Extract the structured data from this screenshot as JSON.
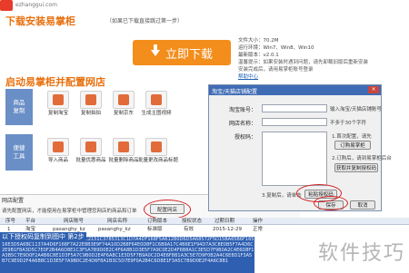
{
  "site": {
    "logo_text": "ezhanggui.com"
  },
  "download": {
    "title": "下载安装易掌柜",
    "subtitle": "（如果已下载直接跳过第一步）",
    "button_label": "立即下载",
    "info_lines": [
      "文件大小：70.2M",
      "运行环境：Win7、Win8、Win10",
      "最新版本：v2.0.1",
      "温馨提示：如果安装时遇到问题，请先卸载旧版后重新安装",
      "安装完成后，请用易掌柜账号登录"
    ],
    "help_link": "帮助中心"
  },
  "config_section": {
    "title": "启动易掌柜并配置网店"
  },
  "categories": [
    {
      "line1": "商品",
      "line2": "复制"
    },
    {
      "line1": "便捷",
      "line2": "工具"
    }
  ],
  "tiles_row1": [
    "复制淘宝",
    "复制拍拍",
    "复制京东",
    "生成主图视频"
  ],
  "tiles_row2": [
    "导入商品",
    "批量优惠商品",
    "批量删除商品",
    "批量更改商品标题"
  ],
  "shop_config": {
    "label": "网店配置",
    "hint": "请先配置网店，才能使用在易掌柜中管理您网店的商品和订单",
    "config_button": "配置网店"
  },
  "dialog": {
    "title": "淘宝/天猫店铺配置",
    "close": "×",
    "fields": [
      {
        "label": "淘宝账号：",
        "hint": "输入淘宝/天猫店铺账号"
      },
      {
        "label": "网店名称：",
        "hint": "不多于30个字符"
      },
      {
        "label": "授权码：",
        "hint": ""
      }
    ],
    "step1": "1.首次配置，请先",
    "order_button": "订购易掌柜",
    "step2": "2.订购后，请到易掌柜后台",
    "get_code_button": "获取并复制授权码",
    "step3": "3.复制后，请单击",
    "paste_button": "粘贴授权码",
    "save_button": "保存",
    "cancel_button": "取消"
  },
  "table": {
    "headers": [
      "序号",
      "平台",
      "网店账号",
      "网店名称",
      "订购版本",
      "授权状态",
      "过期日期",
      "操作"
    ],
    "rows": [
      [
        "1",
        "淘宝",
        "pasanghy_kz",
        "pasanghy_kz",
        "标准版",
        "有效",
        "2015-12-29",
        "正常"
      ]
    ]
  },
  "auth_code_caption": "以下授权码复制到图中 第2步",
  "auth_code_hex": "CA6D7A4DF168F5179E0B6B6792C3C2151C3785313C1D7A4DF168F5A612B0D6D5A68572F5D15BA65B6F16516E3D5A6BC1137A4D6F168F7A22E8B3E9F74A10D2B8F64E0D8F1C6B9A17C4B6E1F94D7A3C8E0B5F7A4D6C2E9B1F8A3D5C7E0F2B4A6D8E1C3F5A7B9D0E2C4F6A8B1D3E5F7A9C0E2D4F6B8A1C3E5D7F9B0A2C4E6D8F1A3B5C7E9D0F2A4B6C8E1D3F5A7C9B0D2E4F6A8C1E3D5F7B9A0C2D4E6F8B1A3C5E7D9F0B2A4C6E8D1F3A5B7C9E0D2F4A6B8C1D3E5F7A9B0C2E4D6F8A1B3C5D7E9F0A2B4C6D8E1F3A5C7B9D0E2F4A6C8B1",
  "watermark": "软件技巧",
  "colors": {
    "accent": "#f38d1b",
    "title": "#e8700e",
    "dialog_title": "#3f6bb5",
    "highlight_ring": "#d42020"
  }
}
